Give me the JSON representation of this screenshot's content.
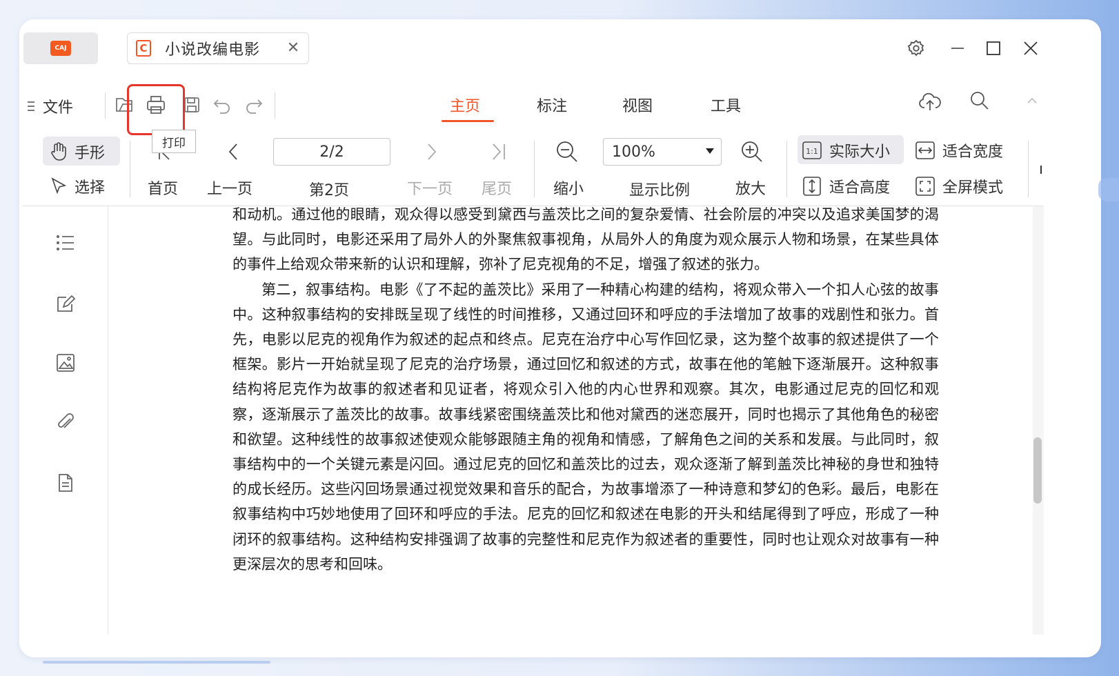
{
  "titlebar": {
    "app_logo_text": "CAJ",
    "tab": {
      "icon_letter": "C",
      "title": "小说改编电影",
      "close": "✕"
    }
  },
  "toolbar": {
    "file_label": "文件",
    "tooltip": "打印",
    "tabs": [
      {
        "label": "主页",
        "active": true
      },
      {
        "label": "标注",
        "active": false
      },
      {
        "label": "视图",
        "active": false
      },
      {
        "label": "工具",
        "active": false
      }
    ]
  },
  "ribbon": {
    "hand": "手形",
    "select": "选择",
    "first_page": "首页",
    "prev_page": "上一页",
    "page_value": "2/2",
    "page_caption": "第2页",
    "next_page": "下一页",
    "last_page": "尾页",
    "zoom_out": "缩小",
    "zoom_value": "100%",
    "zoom_caption": "显示比例",
    "zoom_in": "放大",
    "actual_size": "实际大小",
    "fit_width": "适合宽度",
    "fit_height": "适合高度",
    "fullscreen": "全屏模式"
  },
  "document": {
    "paragraphs": [
      {
        "indent": false,
        "text": "和动机。通过他的眼睛，观众得以感受到黛西与盖茨比之间的复杂爱情、社会阶层的冲突以及追求美国梦的渴望。与此同时，电影还采用了局外人的外聚焦叙事视角，从局外人的角度为观众展示人物和场景，在某些具体的事件上给观众带来新的认识和理解，弥补了尼克视角的不足，增强了叙述的张力。"
      },
      {
        "indent": true,
        "text": "第二，叙事结构。电影《了不起的盖茨比》采用了一种精心构建的结构，将观众带入一个扣人心弦的故事中。这种叙事结构的安排既呈现了线性的时间推移，又通过回环和呼应的手法增加了故事的戏剧性和张力。首先，电影以尼克的视角作为叙述的起点和终点。尼克在治疗中心写作回忆录，这为整个故事的叙述提供了一个框架。影片一开始就呈现了尼克的治疗场景，通过回忆和叙述的方式，故事在他的笔触下逐渐展开。这种叙事结构将尼克作为故事的叙述者和见证者，将观众引入他的内心世界和观察。其次，电影通过尼克的回忆和观察，逐渐展示了盖茨比的故事。故事线紧密围绕盖茨比和他对黛西的迷恋展开，同时也揭示了其他角色的秘密和欲望。这种线性的故事叙述使观众能够跟随主角的视角和情感，了解角色之间的关系和发展。与此同时，叙事结构中的一个关键元素是闪回。通过尼克的回忆和盖茨比的过去，观众逐渐了解到盖茨比神秘的身世和独特的成长经历。这些闪回场景通过视觉效果和音乐的配合，为故事增添了一种诗意和梦幻的色彩。最后，电影在叙事结构中巧妙地使用了回环和呼应的手法。尼克的回忆和叙述在电影的开头和结尾得到了呼应，形成了一种闭环的叙事结构。这种结构安排强调了故事的完整性和尼克作为叙述者的重要性，同时也让观众对故事有一种更深层次的思考和回味。"
      }
    ]
  },
  "colors": {
    "accent": "#f0562a",
    "highlight": "#e8352b"
  }
}
